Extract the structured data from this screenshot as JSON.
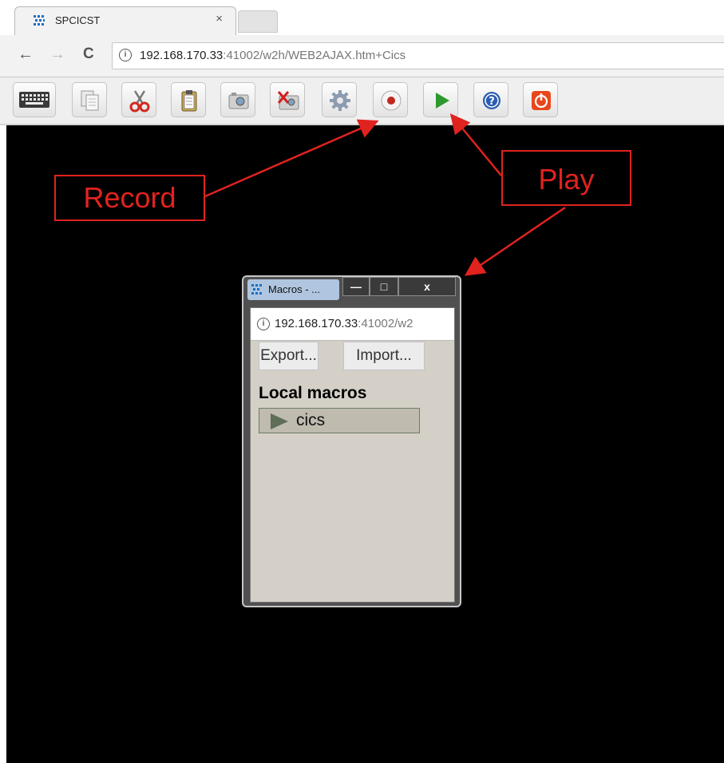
{
  "browser": {
    "tab_title": "SPCICST",
    "tab_close": "×",
    "url_host": "192.168.170.33",
    "url_rest": ":41002/w2h/WEB2AJAX.htm+Cics",
    "nav_back": "←",
    "nav_forward": "→",
    "nav_reload": "C"
  },
  "toolbar": {
    "buttons": [
      {
        "name": "keyboard-button",
        "icon": "keyboard-icon"
      },
      {
        "name": "copy-button",
        "icon": "copy-icon"
      },
      {
        "name": "cut-button",
        "icon": "scissors-icon"
      },
      {
        "name": "paste-button",
        "icon": "clipboard-icon"
      },
      {
        "name": "screenshot-button",
        "icon": "camera-icon"
      },
      {
        "name": "close-screenshot-button",
        "icon": "camera-x-icon"
      },
      {
        "name": "settings-button",
        "icon": "gear-icon"
      },
      {
        "name": "record-button",
        "icon": "record-icon"
      },
      {
        "name": "play-button",
        "icon": "play-icon"
      },
      {
        "name": "help-button",
        "icon": "help-icon"
      },
      {
        "name": "power-button",
        "icon": "power-icon"
      }
    ],
    "colors": {
      "record": "#c0281e",
      "play": "#2e9a2e",
      "help": "#2a5db0",
      "power": "#e8471c"
    }
  },
  "annotations": {
    "record_label": "Record",
    "play_label": "Play",
    "color": "#e0231f"
  },
  "popup": {
    "title": "Macros - ...",
    "minimize": "—",
    "maximize": "□",
    "close": "x",
    "url_host": "192.168.170.33",
    "url_rest": ":41002/w2",
    "export_label": "Export...",
    "import_label": "Import...",
    "local_macros_heading": "Local macros",
    "macros": [
      "cics"
    ]
  }
}
